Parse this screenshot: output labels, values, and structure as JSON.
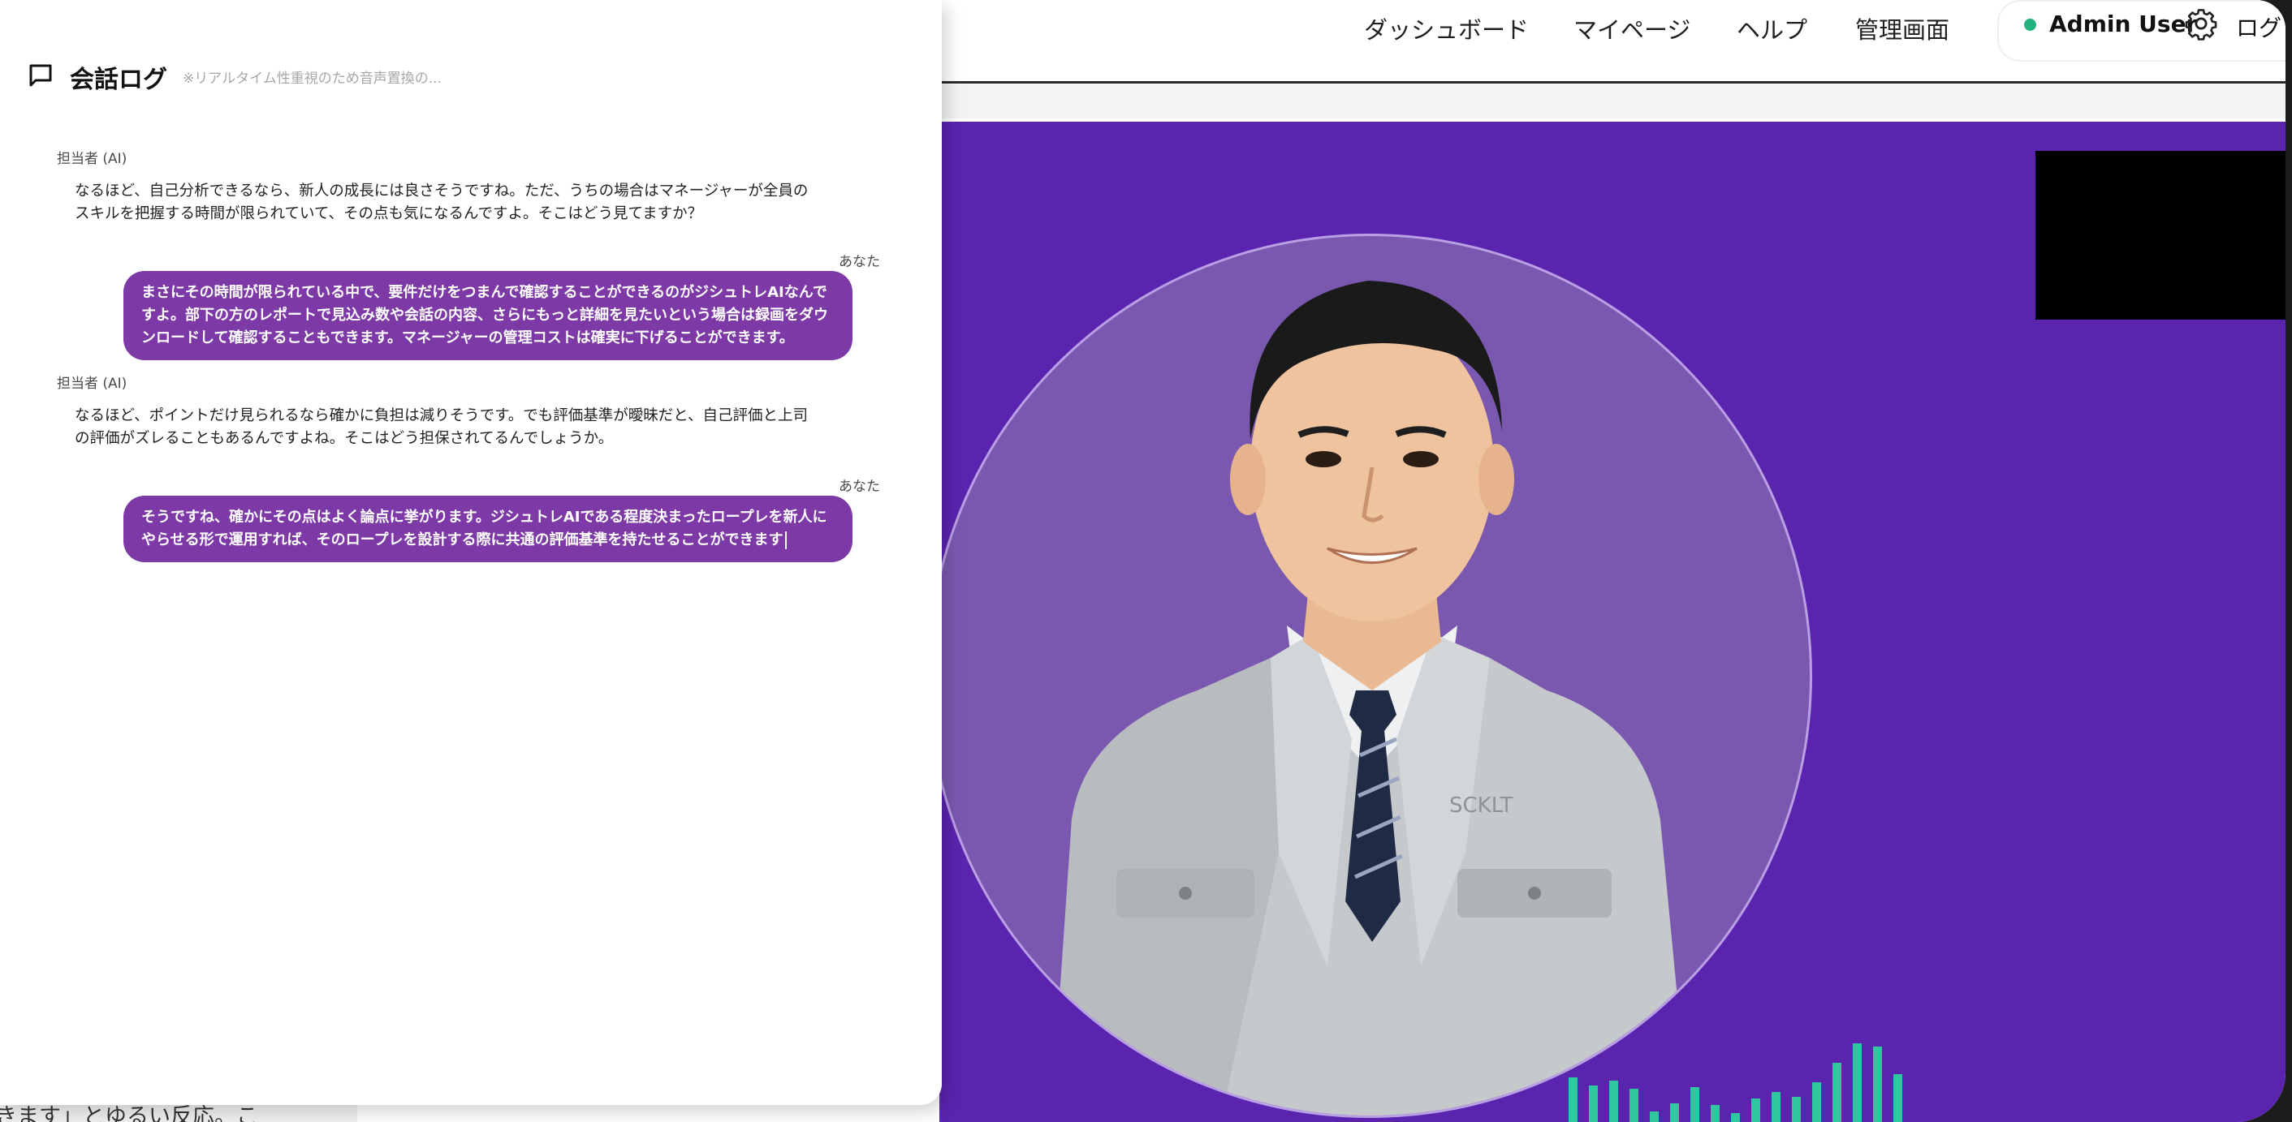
{
  "nav": {
    "links": [
      "ダッシュボード",
      "マイページ",
      "ヘルプ",
      "管理画面"
    ],
    "user_name": "Admin User",
    "logout_partial": "ログ"
  },
  "chat": {
    "title": "会話ログ",
    "note": "※リアルタイム性重視のため音声置換の...",
    "messages": [
      {
        "speaker": "担当者 (AI)",
        "text": "なるほど、自己分析できるなら、新人の成長には良さそうですね。ただ、うちの場合はマネージャーが全員のスキルを把握する時間が限られていて、その点も気になるんですよ。そこはどう見てますか？"
      },
      {
        "speaker": "あなた",
        "text": "まさにその時間が限られている中で、要件だけをつまんで確認することができるのがジシュトレAIなんですよ。部下の方のレポートで見込み数や会話の内容、さらにもっと詳細を見たいという場合は録画をダウンロードして確認することもできます。マネージャーの管理コストは確実に下げることができます。"
      },
      {
        "speaker": "担当者 (AI)",
        "text": "なるほど、ポイントだけ見られるなら確かに負担は減りそうです。でも評価基準が曖昧だと、自己評価と上司の評価がズレることもあるんですよね。そこはどう担保されてるんでしょうか。"
      },
      {
        "speaker": "あなた",
        "text": "そうですね、確かにその点はよく論点に挙がります。ジシュトレAIである程度決まったロープレを新人にやらせる形で運用すれば、そのロープレを設計する際に共通の評価基準を持たせることができます"
      }
    ]
  },
  "stage": {
    "badge_text": "SCKLT"
  },
  "background": {
    "partial_text": "きます」とゆるい反応。こ"
  },
  "colors": {
    "stage_bg": "#5a24ae",
    "user_bubble": "#7d3aa6",
    "status_online": "#22b07d",
    "waveform": "#2ec7a0"
  },
  "icons": [
    "chat-bubble-icon",
    "gear-icon",
    "status-dot"
  ]
}
